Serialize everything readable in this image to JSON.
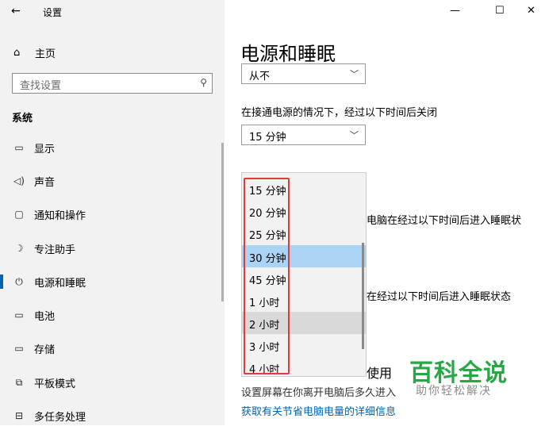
{
  "window": {
    "title": "设置",
    "back_icon": "←",
    "min_icon": "—",
    "max_icon": "☐",
    "close_icon": "✕"
  },
  "sidebar": {
    "home_icon": "⌂",
    "home_label": "主页",
    "search_placeholder": "查找设置",
    "search_icon": "⚲",
    "section_title": "系统",
    "items": [
      {
        "icon": "▭",
        "label": "显示"
      },
      {
        "icon": "◁)",
        "label": "声音"
      },
      {
        "icon": "▢",
        "label": "通知和操作"
      },
      {
        "icon": "☽",
        "label": "专注助手"
      },
      {
        "icon": "⏻",
        "label": "电源和睡眠"
      },
      {
        "icon": "▭",
        "label": "电池"
      },
      {
        "icon": "▭",
        "label": "存储"
      },
      {
        "icon": "⧉",
        "label": "平板模式"
      },
      {
        "icon": "⊟",
        "label": "多任务处理"
      }
    ]
  },
  "main": {
    "page_title": "电源和睡眠",
    "combo_top_value": "从不",
    "combo_icon": "﹀",
    "screen_plugged_label": "在接通电源的情况下，经过以下时间后关闭",
    "combo_screen_value": "15 分钟",
    "sleep_label_1": "电脑在经过以下时间后进入睡眠状",
    "sleep_label_2": "在经过以下时间后进入睡眠状态",
    "use_partial": "使用",
    "sub_desc": "设置屏幕在你离开电脑后多久进入",
    "link": "获取有关节省电脑电量的详细信息",
    "dropdown_options": [
      "15 分钟",
      "20 分钟",
      "25 分钟",
      "30 分钟",
      "45 分钟",
      "1 小时",
      "2 小时",
      "3 小时",
      "4 小时"
    ],
    "dropdown_selected": "30 分钟"
  },
  "watermark": {
    "main": "百科全说",
    "sub": "助你轻松解决"
  }
}
